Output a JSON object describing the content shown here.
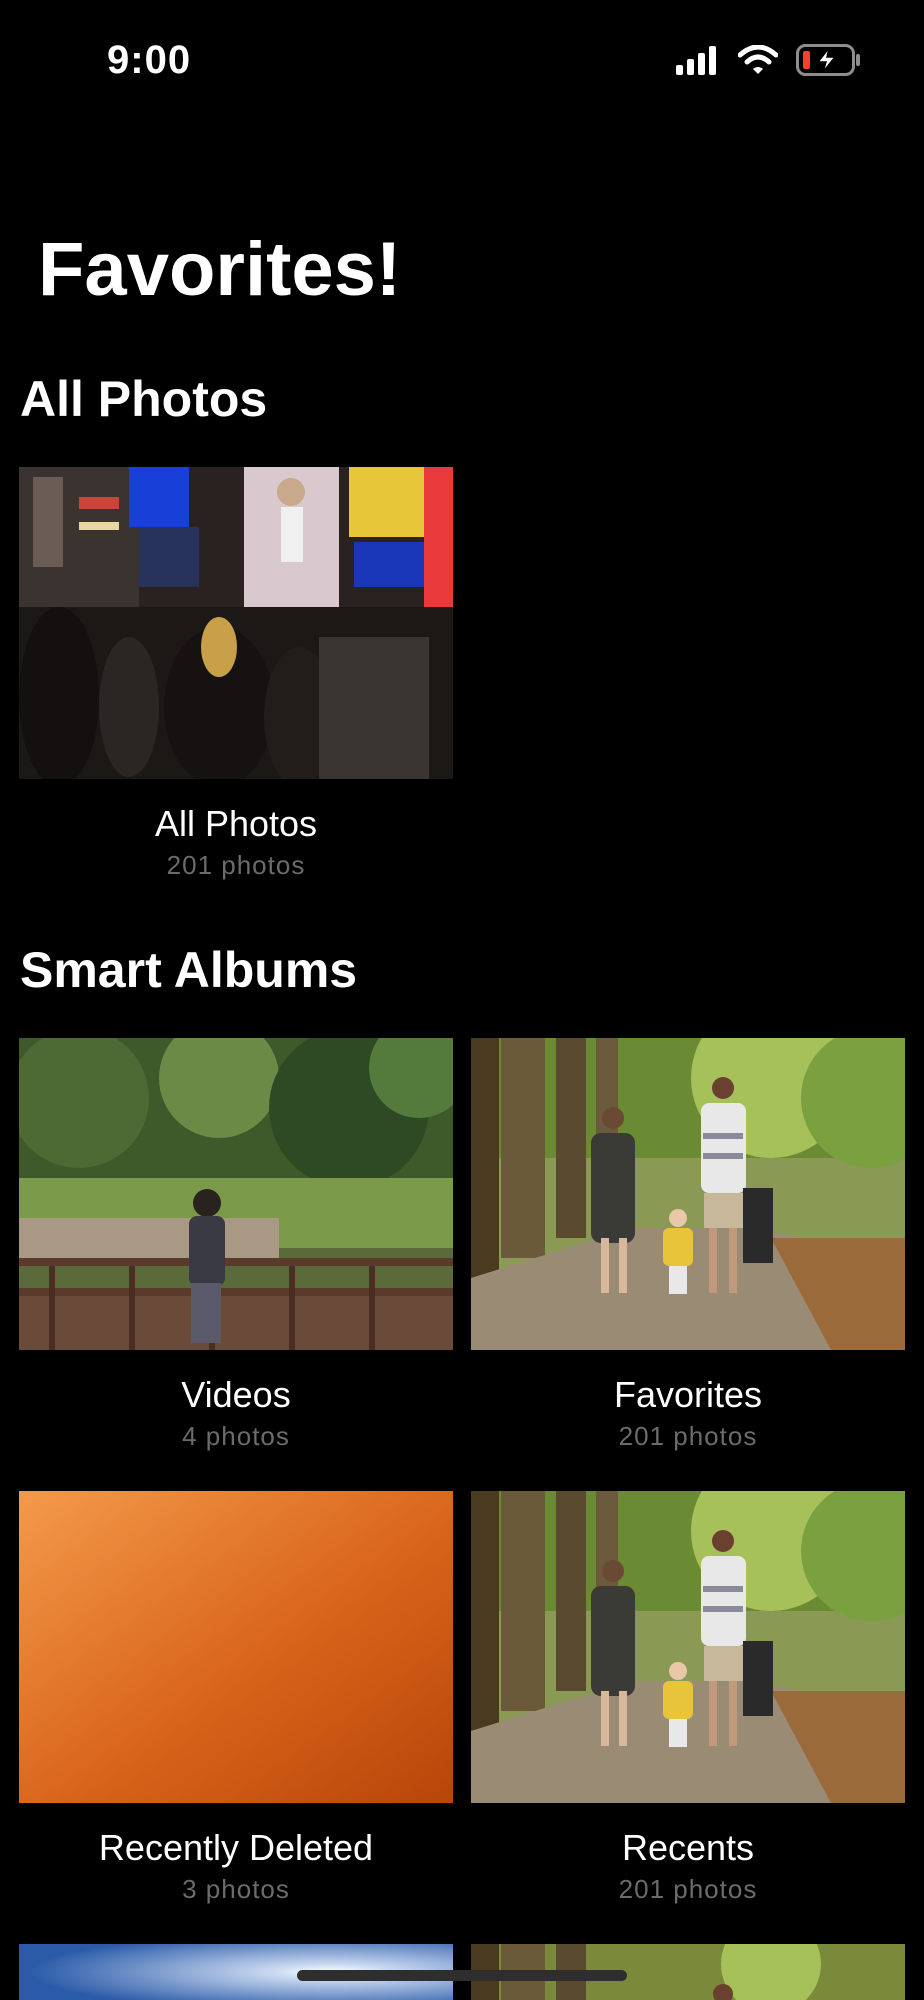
{
  "status_bar": {
    "time": "9:00",
    "icons": [
      "cellular-signal-icon",
      "wifi-icon",
      "battery-charging-icon"
    ],
    "battery_color": "#ff3b30"
  },
  "title": "Favorites!",
  "sections": {
    "all_photos": {
      "title": "All Photos",
      "albums": [
        {
          "name": "All Photos",
          "count": "201 photos"
        }
      ]
    },
    "smart_albums": {
      "title": "Smart Albums",
      "albums": [
        {
          "name": "Videos",
          "count": "4 photos"
        },
        {
          "name": "Favorites",
          "count": "201 photos"
        },
        {
          "name": "Recently Deleted",
          "count": "3 photos"
        },
        {
          "name": "Recents",
          "count": "201 photos"
        }
      ]
    }
  },
  "colors": {
    "background": "#000000",
    "text_primary": "#ffffff",
    "text_secondary": "#6b6b6b",
    "orange_gradient": [
      "#f49a4a",
      "#d8641a",
      "#b84509"
    ]
  }
}
